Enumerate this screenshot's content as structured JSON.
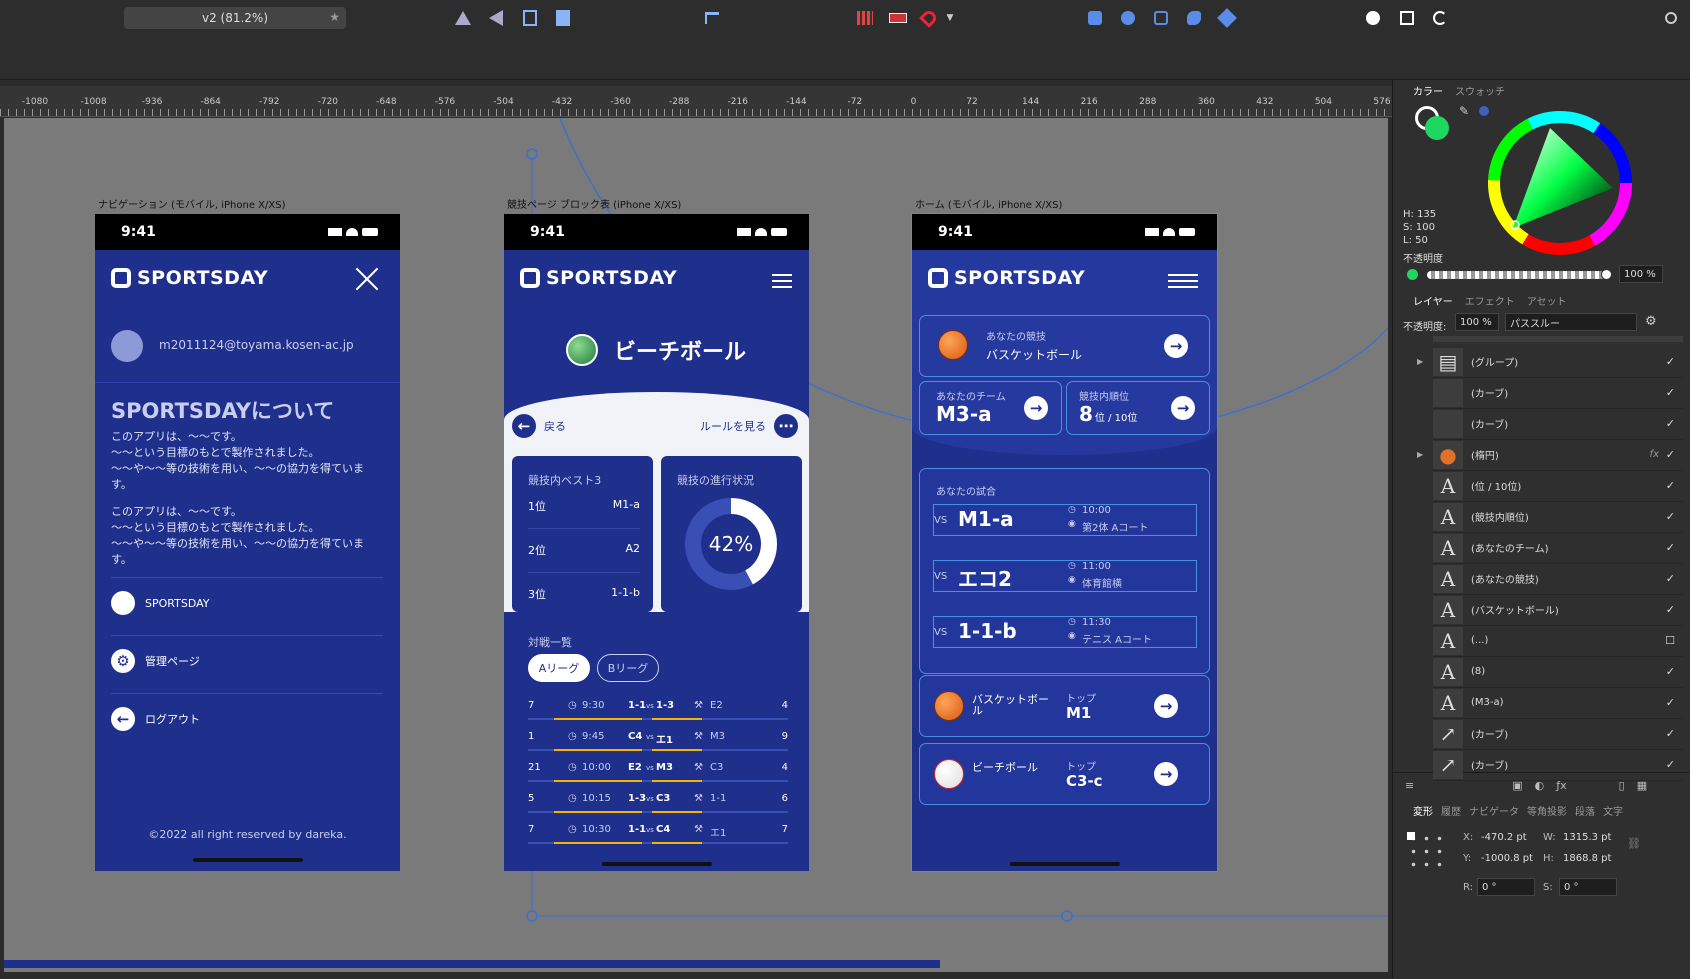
{
  "toolbar": {
    "document_name": "v2 (81.2%)"
  },
  "ruler": {
    "ticks": [
      "-1080",
      "-1008",
      "-936",
      "-864",
      "-792",
      "-720",
      "-648",
      "-576",
      "-504",
      "-432",
      "-360",
      "-288",
      "-216",
      "-144",
      "-72",
      "0",
      "72",
      "144",
      "216",
      "288",
      "360",
      "432",
      "504",
      "576"
    ]
  },
  "artboards": {
    "nav": {
      "label": "ナビゲーション (モバイル, iPhone X/XS)",
      "time": "9:41",
      "brand": "SPORTSDAY",
      "email": "m2011124@toyama.kosen-ac.jp",
      "about_title": "SPORTSDAYについて",
      "para1": "このアプリは、〜〜です。\n〜〜という目標のもとで製作されました。\n〜〜や〜〜等の技術を用い、〜〜の協力を得ています。",
      "para2": "このアプリは、〜〜です。\n〜〜という目標のもとで製作されました。\n〜〜や〜〜等の技術を用い、〜〜の協力を得ています。",
      "link_github": "SPORTSDAY",
      "link_admin": "管理ページ",
      "link_logout": "ログアウト",
      "footer": "©2022 all right reserved by dareka."
    },
    "sport": {
      "label": "競技ページ ブロック表 (iPhone X/XS)",
      "time": "9:41",
      "brand": "SPORTSDAY",
      "title": "ビーチボール",
      "back": "戻る",
      "rules": "ルールを見る",
      "best3_title": "競技内ベスト3",
      "best3": [
        {
          "rank": "1位",
          "team": "M1-a"
        },
        {
          "rank": "2位",
          "team": "A2"
        },
        {
          "rank": "3位",
          "team": "1-1-b"
        }
      ],
      "progress_title": "競技の進行状況",
      "progress_label": "42%",
      "progress": 0.42,
      "matches_title": "対戦一覧",
      "league_a": "Aリーグ",
      "league_b": "Bリーグ",
      "matches": [
        {
          "ls": "7",
          "time": "9:30",
          "t1": "1-1",
          "vs": "vs",
          "t2": "1-3",
          "place": "E2",
          "rs": "4"
        },
        {
          "ls": "1",
          "time": "9:45",
          "t1": "C4",
          "vs": "vs",
          "t2": "エ1",
          "place": "M3",
          "rs": "9"
        },
        {
          "ls": "21",
          "time": "10:00",
          "t1": "E2",
          "vs": "vs",
          "t2": "M3",
          "place": "C3",
          "rs": "4"
        },
        {
          "ls": "5",
          "time": "10:15",
          "t1": "1-3",
          "vs": "vs",
          "t2": "C3",
          "place": "1-1",
          "rs": "6"
        },
        {
          "ls": "7",
          "time": "10:30",
          "t1": "1-1",
          "vs": "vs",
          "t2": "C4",
          "place": "エ1",
          "rs": "7"
        }
      ]
    },
    "home": {
      "label": "ホーム (モバイル, iPhone X/XS)",
      "time": "9:41",
      "brand": "SPORTSDAY",
      "your_sport_label": "あなたの競技",
      "your_sport": "バスケットボール",
      "your_team_label": "あなたのチーム",
      "your_team": "M3-a",
      "rank_label": "競技内順位",
      "rank": "8",
      "rank_suffix": "位 / 10位",
      "your_match_label": "あなたの試合",
      "games": [
        {
          "vs": "VS",
          "team": "M1-a",
          "time": "10:00",
          "place": "第2体 Aコート"
        },
        {
          "vs": "VS",
          "team": "エコ2",
          "time": "11:00",
          "place": "体育館横"
        },
        {
          "vs": "VS",
          "team": "1-1-b",
          "time": "11:30",
          "place": "テニス Aコート"
        }
      ],
      "sports": [
        {
          "name": "バスケットボール",
          "top_label": "トップ",
          "top": "M1"
        },
        {
          "name": "ビーチボール",
          "top_label": "トップ",
          "top": "C3-c"
        }
      ]
    }
  },
  "panel": {
    "color_tabs": [
      "カラー",
      "スウォッチ"
    ],
    "hsl": {
      "h": "H: 135",
      "s": "S: 100",
      "l": "L: 50"
    },
    "opacity_label": "不透明度",
    "opacity_value": "100 %",
    "layer_tabs": [
      "レイヤー",
      "エフェクト",
      "アセット"
    ],
    "layer_opacity_label": "不透明度:",
    "layer_opacity_value": "100 %",
    "blend_mode": "パススルー",
    "layers": [
      "(グループ)",
      "(カーブ)",
      "(カーブ)",
      "(楕円)",
      "(位 / 10位)",
      "(競技内順位)",
      "(あなたのチーム)",
      "(あなたの競技)",
      "(バスケットボール)",
      "(...)",
      "(8)",
      "(M3-a)",
      "(カーブ)",
      "(カーブ)"
    ],
    "transform_tabs": [
      "変形",
      "履歴",
      "ナビゲータ",
      "等角投影",
      "段落",
      "文字"
    ],
    "transform": {
      "x_label": "X:",
      "x": "-470.2 pt",
      "w_label": "W:",
      "w": "1315.3 pt",
      "y_label": "Y:",
      "y": "-1000.8 pt",
      "h_label": "H:",
      "h": "1868.8 pt",
      "r_label": "R:",
      "r": "0 °",
      "s_label": "S:",
      "s": "0 °"
    },
    "accent_color": "#1ed760"
  }
}
